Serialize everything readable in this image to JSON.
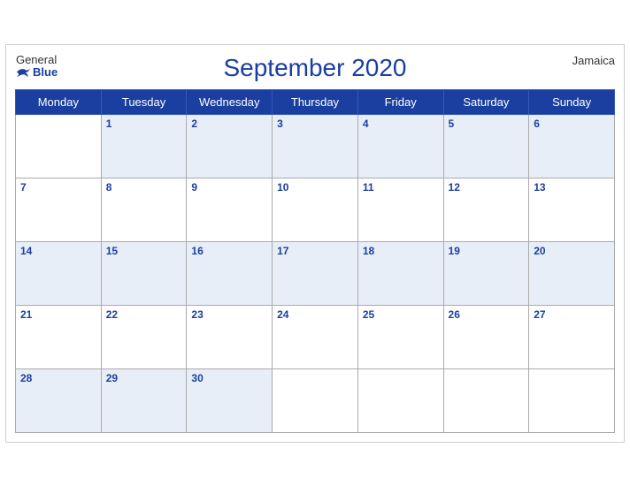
{
  "calendar": {
    "title": "September 2020",
    "country": "Jamaica",
    "logo": {
      "general": "General",
      "blue": "Blue"
    },
    "days_of_week": [
      "Monday",
      "Tuesday",
      "Wednesday",
      "Thursday",
      "Friday",
      "Saturday",
      "Sunday"
    ],
    "weeks": [
      [
        null,
        "1",
        "2",
        "3",
        "4",
        "5",
        "6"
      ],
      [
        "7",
        "8",
        "9",
        "10",
        "11",
        "12",
        "13"
      ],
      [
        "14",
        "15",
        "16",
        "17",
        "18",
        "19",
        "20"
      ],
      [
        "21",
        "22",
        "23",
        "24",
        "25",
        "26",
        "27"
      ],
      [
        "28",
        "29",
        "30",
        null,
        null,
        null,
        null
      ]
    ]
  }
}
